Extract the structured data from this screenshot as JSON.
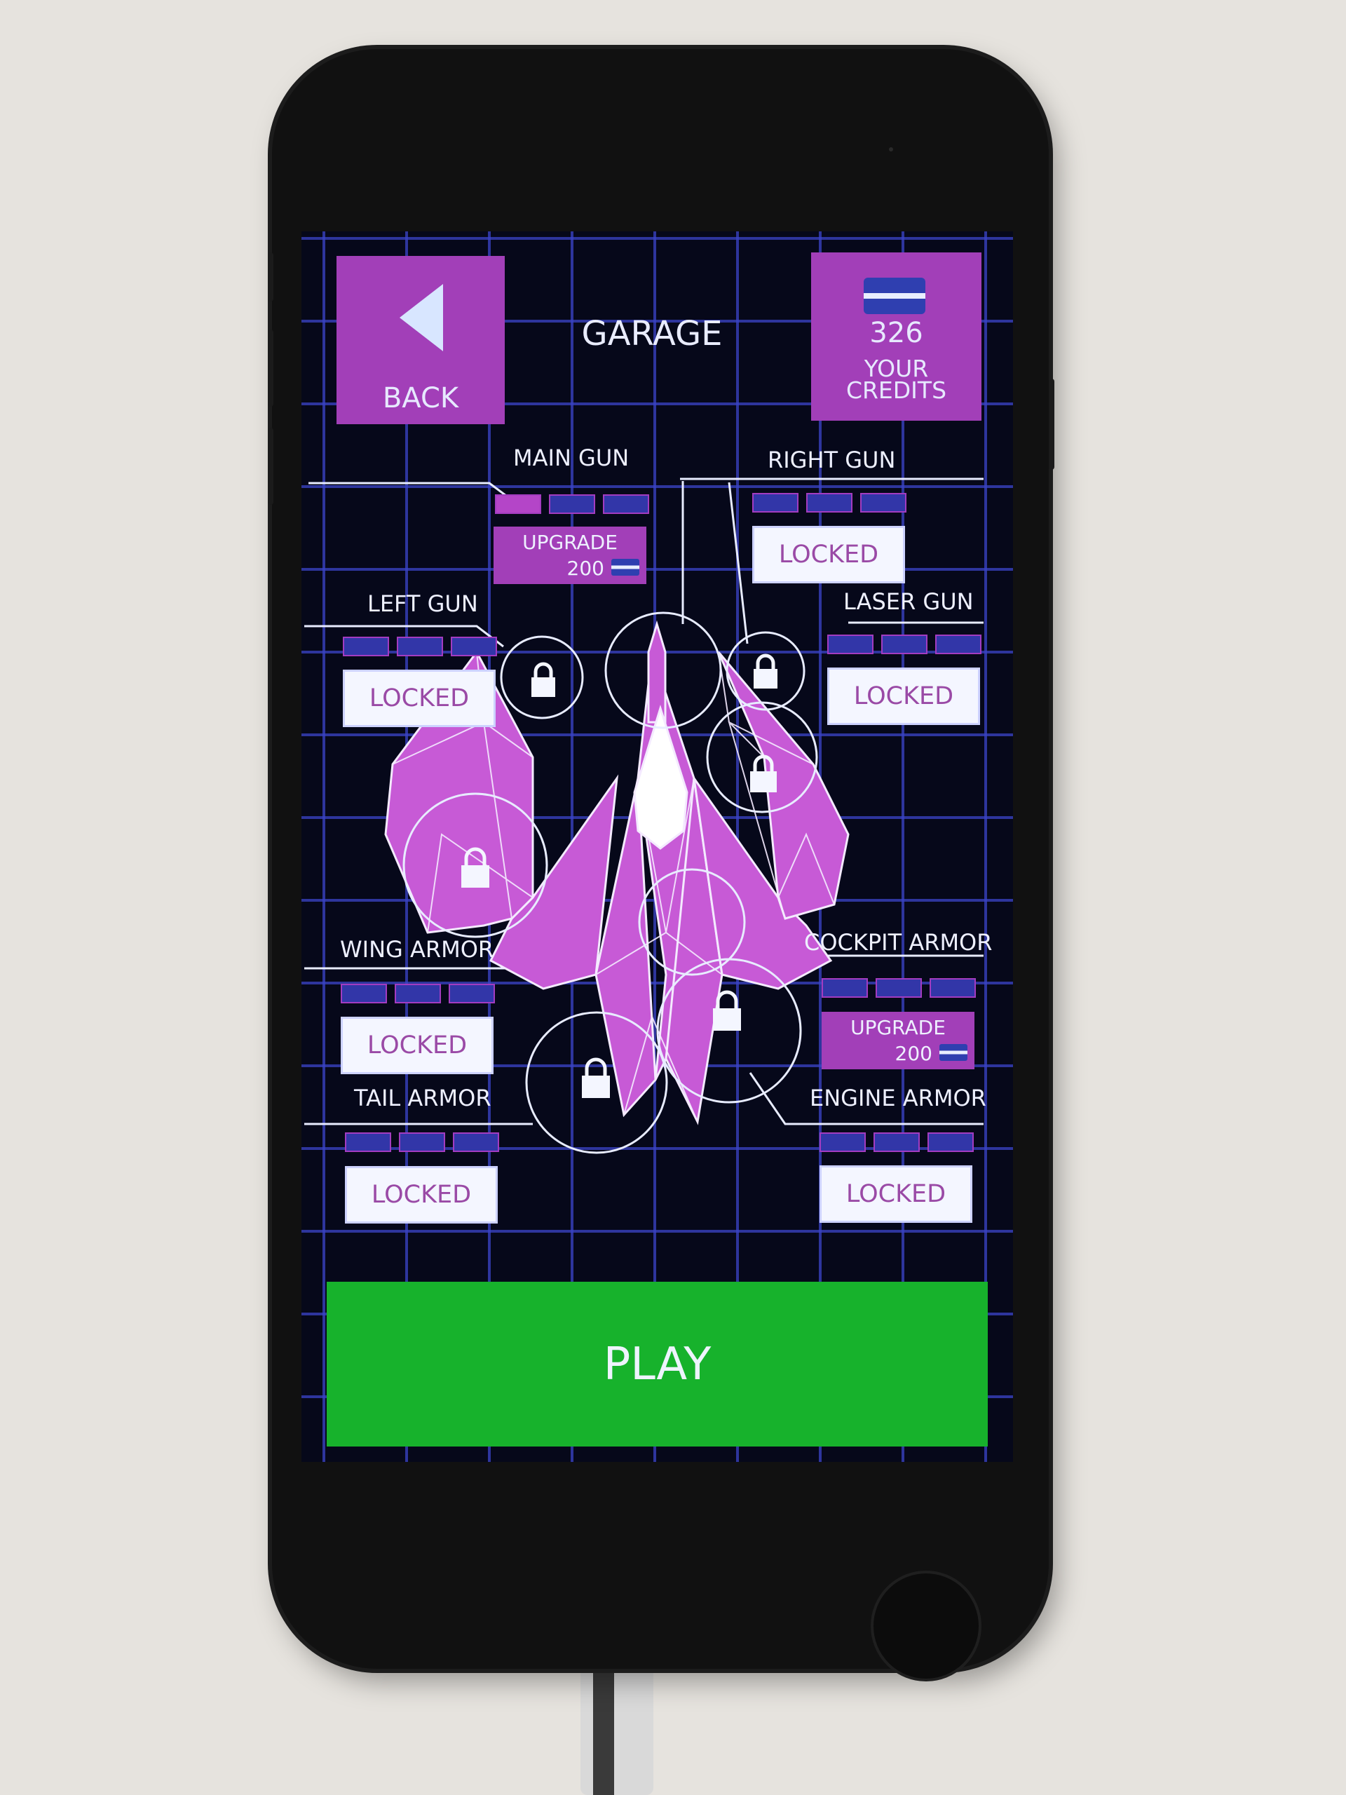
{
  "header": {
    "title": "GARAGE",
    "back_label": "BACK",
    "credits_amount": "326",
    "credits_label": "YOUR CREDITS"
  },
  "slots": [
    {
      "name": "MAIN GUN",
      "levels_filled": 1,
      "levels_total": 3,
      "action": "UPGRADE",
      "cost": "200"
    },
    {
      "name": "RIGHT GUN",
      "levels_filled": 0,
      "levels_total": 3,
      "action": "LOCKED"
    },
    {
      "name": "LEFT GUN",
      "levels_filled": 0,
      "levels_total": 3,
      "action": "LOCKED"
    },
    {
      "name": "LASER GUN",
      "levels_filled": 0,
      "levels_total": 3,
      "action": "LOCKED"
    },
    {
      "name": "WING ARMOR",
      "levels_filled": 0,
      "levels_total": 3,
      "action": "LOCKED"
    },
    {
      "name": "COCKPIT ARMOR",
      "levels_filled": 0,
      "levels_total": 3,
      "action": "UPGRADE",
      "cost": "200"
    },
    {
      "name": "TAIL ARMOR",
      "levels_filled": 0,
      "levels_total": 3,
      "action": "LOCKED"
    },
    {
      "name": "ENGINE ARMOR",
      "levels_filled": 0,
      "levels_total": 3,
      "action": "LOCKED"
    }
  ],
  "play_label": "PLAY",
  "colors": {
    "panel_purple": "#a23fb8",
    "ship_pink": "#c75ad6",
    "grid_blue": "#3a44c8",
    "play_green": "#17b22c",
    "background": "#06081a"
  },
  "icons": {
    "back": "back-arrow-icon",
    "credits": "credit-card-icon",
    "slot_lock": "padlock-icon"
  }
}
